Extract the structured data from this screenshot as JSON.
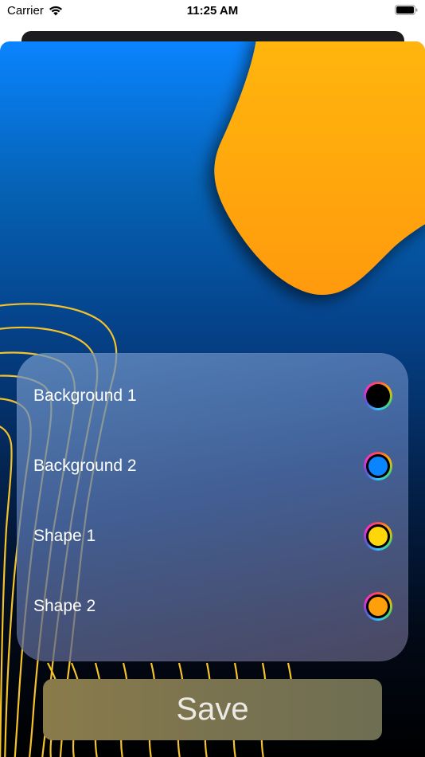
{
  "status_bar": {
    "carrier": "Carrier",
    "time": "11:25 AM"
  },
  "colors": {
    "background_1": "#000000",
    "background_2": "#0a84ff",
    "shape_1": "#ffd60a",
    "shape_2": "#ff9f0a"
  },
  "settings": {
    "rows": [
      {
        "label": "Background 1",
        "color": "#000000"
      },
      {
        "label": "Background 2",
        "color": "#0a84ff"
      },
      {
        "label": "Shape 1",
        "color": "#ffd60a"
      },
      {
        "label": "Shape 2",
        "color": "#ff9f0a"
      }
    ]
  },
  "save_label": "Save"
}
